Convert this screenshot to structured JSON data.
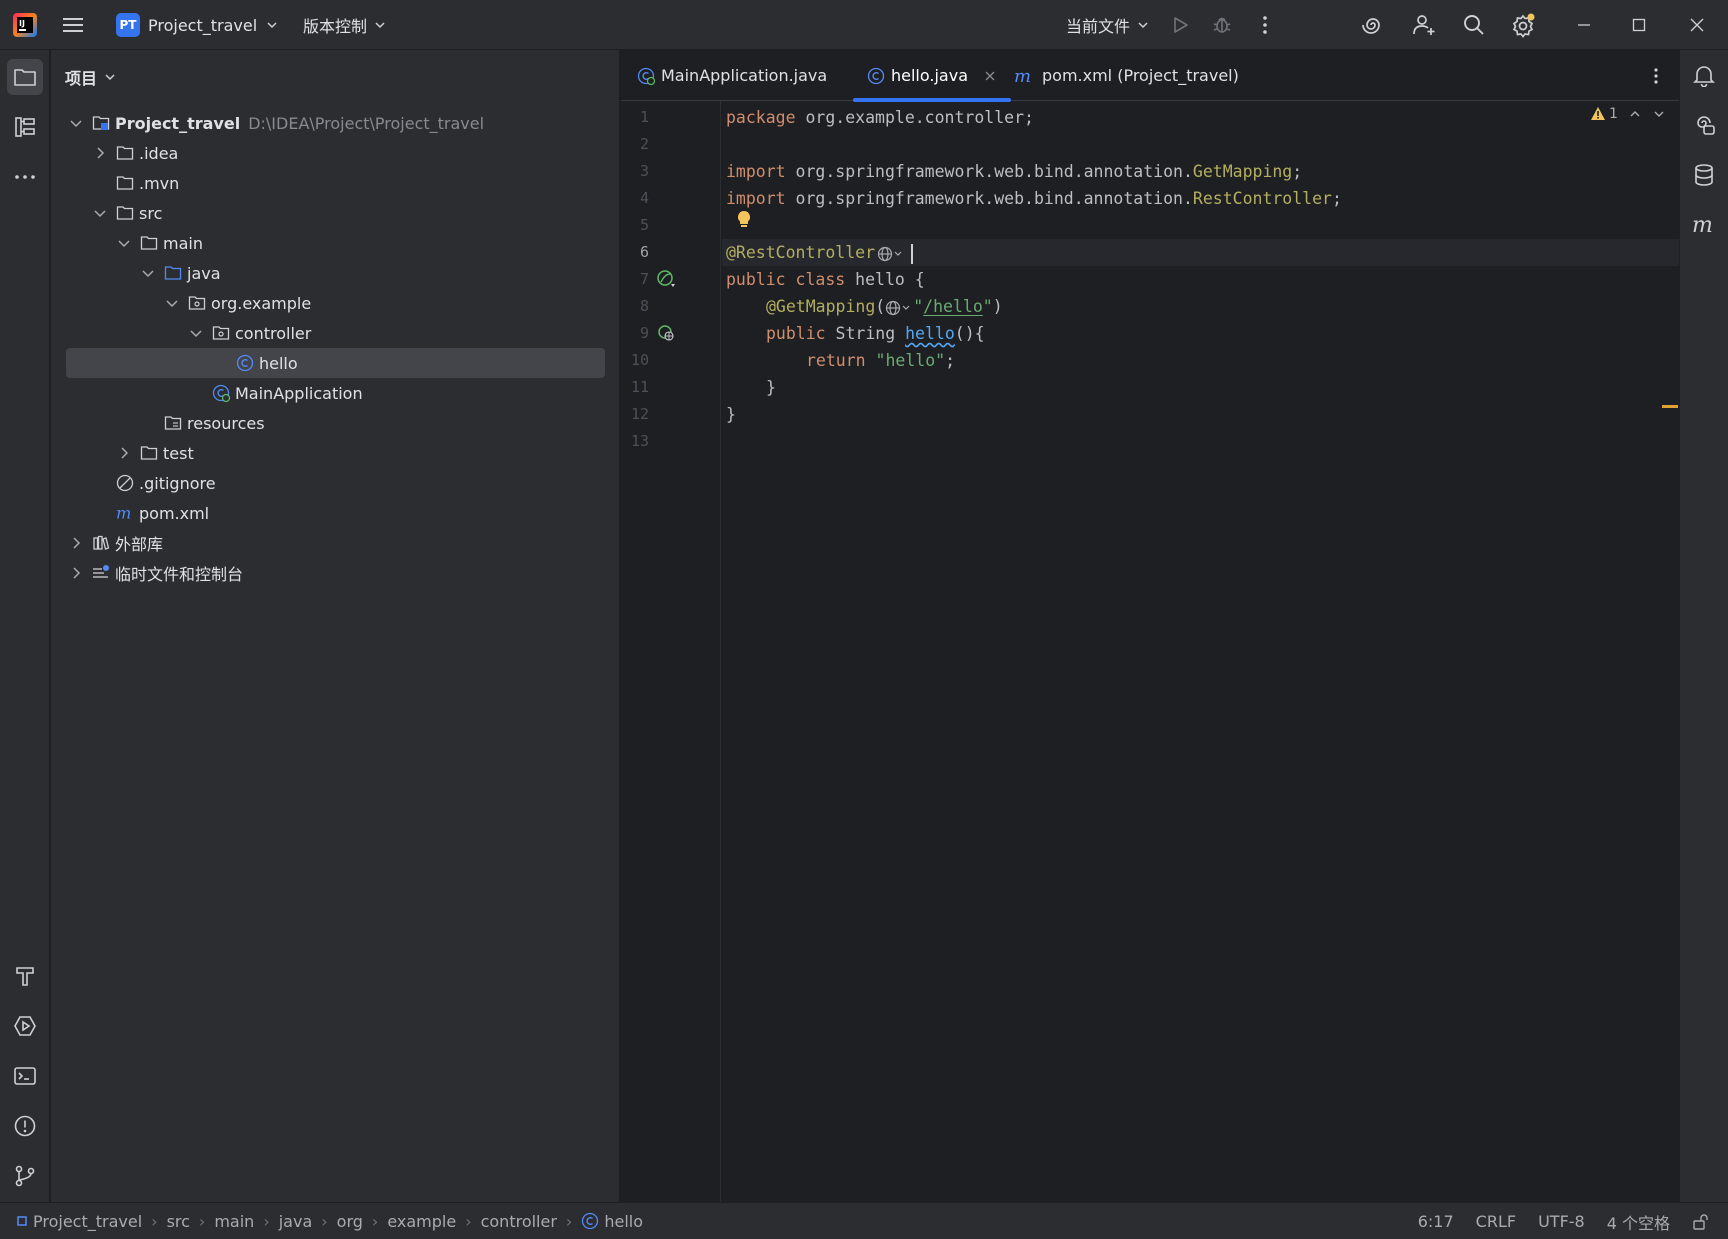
{
  "titlebar": {
    "project_badge": "PT",
    "project_name": "Project_travel",
    "vcs_label": "版本控制",
    "run_config": "当前文件"
  },
  "project_panel": {
    "header": "项目",
    "root_name": "Project_travel",
    "root_path": "D:\\IDEA\\Project\\Project_travel",
    "items": [
      {
        "label": ".idea"
      },
      {
        "label": ".mvn"
      },
      {
        "label": "src"
      },
      {
        "label": "main"
      },
      {
        "label": "java"
      },
      {
        "label": "org.example"
      },
      {
        "label": "controller"
      },
      {
        "label": "hello"
      },
      {
        "label": "MainApplication"
      },
      {
        "label": "resources"
      },
      {
        "label": "test"
      },
      {
        "label": ".gitignore"
      },
      {
        "label": "pom.xml"
      },
      {
        "label": "外部库"
      },
      {
        "label": "临时文件和控制台"
      }
    ]
  },
  "editor": {
    "tabs": [
      {
        "label": "MainApplication.java"
      },
      {
        "label": "hello.java"
      },
      {
        "label": "pom.xml (Project_travel)"
      }
    ],
    "warning_count": "1",
    "line_numbers": [
      "1",
      "2",
      "3",
      "4",
      "5",
      "6",
      "7",
      "8",
      "9",
      "10",
      "11",
      "12",
      "13"
    ],
    "code": {
      "l1_kw": "package",
      "l1_rest": " org.example.controller;",
      "l3_kw": "import",
      "l3_mid": " org.springframework.web.bind.annotation.",
      "l3_cls": "GetMapping",
      "l3_end": ";",
      "l4_kw": "import",
      "l4_mid": " org.springframework.web.bind.annotation.",
      "l4_cls": "RestController",
      "l4_end": ";",
      "l6_ann": "@RestController",
      "l7_kw1": "public",
      "l7_kw2": "class",
      "l7_rest": " hello {",
      "l8_ann": "@GetMapping",
      "l8_open": "(",
      "l8_q1": "\"",
      "l8_path": "/hello",
      "l8_q2": "\"",
      "l8_close": ")",
      "l9_kw": "public",
      "l9_type": " String ",
      "l9_fn": "hello",
      "l9_rest": "(){",
      "l10_kw": "return",
      "l10_str": "\"hello\"",
      "l10_end": ";",
      "l11": "}",
      "l12": "}"
    }
  },
  "statusbar": {
    "crumbs": [
      "Project_travel",
      "src",
      "main",
      "java",
      "org",
      "example",
      "controller",
      "hello"
    ],
    "position": "6:17",
    "line_sep": "CRLF",
    "encoding": "UTF-8",
    "indent": "4 个空格"
  },
  "colors": {
    "accent": "#3574f0",
    "keyword": "#cf8e6d",
    "annotation": "#b3ae60",
    "string": "#6aab73",
    "warning": "#f2c55c"
  }
}
